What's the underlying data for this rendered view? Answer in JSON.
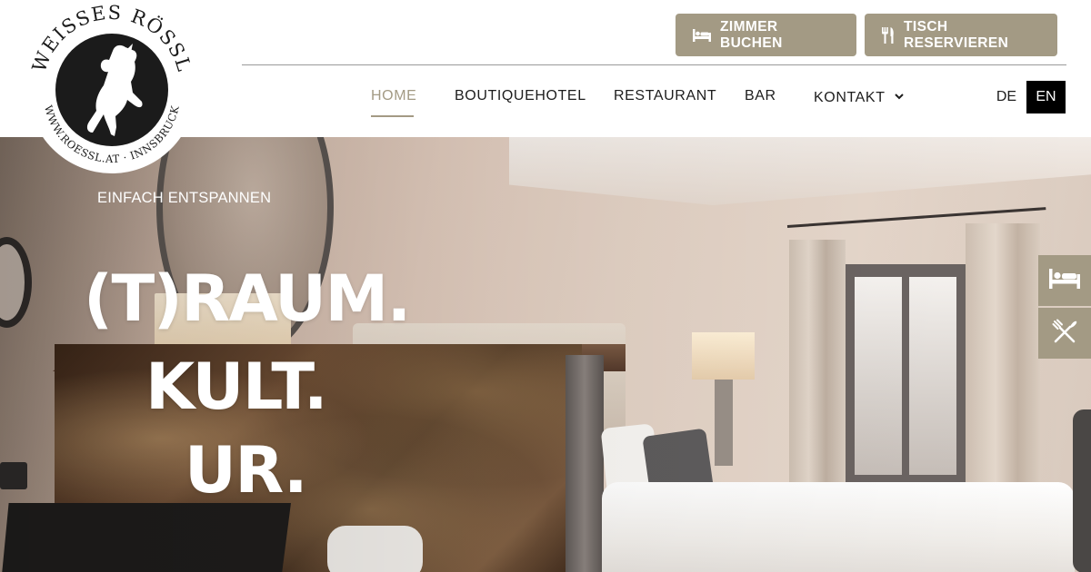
{
  "brand": {
    "name_arc": "WEISSES RÖSSL",
    "url_arc": "WWW.ROESSL.AT · INNSBRUCK"
  },
  "header": {
    "cta_rooms": {
      "label": "ZIMMER BUCHEN",
      "icon": "bed-icon"
    },
    "cta_table": {
      "label": "TISCH RESERVIEREN",
      "icon": "cutlery-icon"
    },
    "nav": [
      {
        "label": "HOME",
        "active": true
      },
      {
        "label": "BOUTIQUEHOTEL",
        "active": false
      },
      {
        "label": "RESTAURANT",
        "active": false
      },
      {
        "label": "BAR",
        "active": false
      },
      {
        "label": "KONTAKT",
        "active": false,
        "icon": "chevron-down-icon"
      }
    ],
    "languages": [
      {
        "label": "DE",
        "active": false
      },
      {
        "label": "EN",
        "active": true
      }
    ]
  },
  "hero": {
    "eyebrow": "EINFACH ENTSPANNEN",
    "lines": [
      "(T)RAUM.",
      "KULT.",
      "UR."
    ]
  },
  "side_widget": [
    {
      "icon": "bed-icon"
    },
    {
      "icon": "cutlery-crossed-icon"
    }
  ],
  "colors": {
    "accent": "#a39a84",
    "text": "#1d1d1d",
    "active_lang_bg": "#000000",
    "white": "#ffffff"
  }
}
